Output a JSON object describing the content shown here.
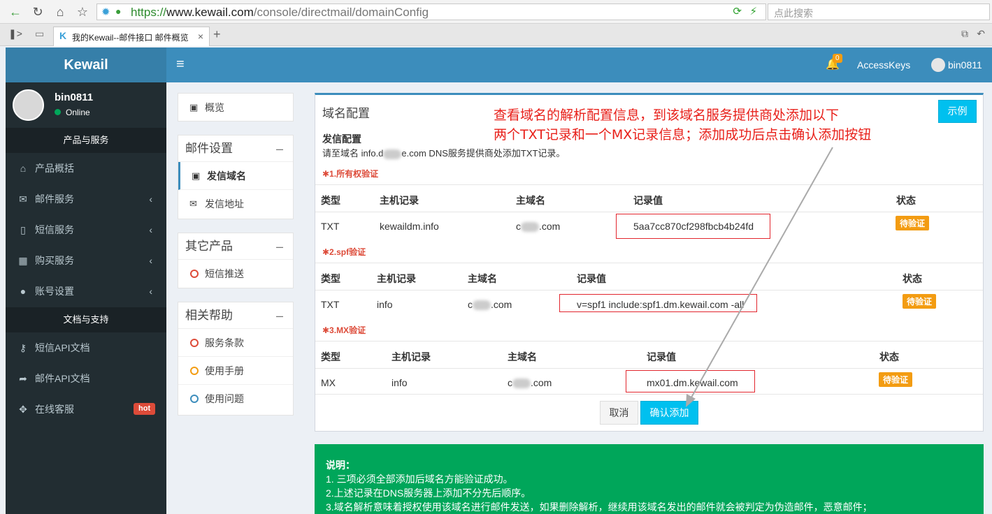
{
  "browser": {
    "url_scheme": "https://",
    "url_domain": "www.kewail.com",
    "url_path": "/console/directmail/domainConfig",
    "search_placeholder": "点此搜索",
    "tab_title": "我的Kewail--邮件接口 邮件概览",
    "new_tab": "+"
  },
  "header": {
    "brand": "Kewail",
    "menu_toggle": "≡",
    "bell_count": "0",
    "access_keys": "AccessKeys",
    "username": "bin0811"
  },
  "sidebar": {
    "user_name": "bin0811",
    "status": "Online",
    "section1": "产品与服务",
    "items1": [
      {
        "icon": "home-icon",
        "label": "产品概括"
      },
      {
        "icon": "envelope-icon",
        "label": "邮件服务"
      },
      {
        "icon": "mobile-icon",
        "label": "短信服务"
      },
      {
        "icon": "grid-icon",
        "label": "购买服务"
      },
      {
        "icon": "user-icon",
        "label": "账号设置"
      }
    ],
    "section2": "文档与支持",
    "items2": [
      {
        "icon": "key-icon",
        "label": "短信API文档"
      },
      {
        "icon": "share-icon",
        "label": "邮件API文档"
      },
      {
        "icon": "move-icon",
        "label": "在线客服",
        "badge": "hot"
      }
    ]
  },
  "left_panel": {
    "overview": "概览",
    "mail_settings": {
      "title": "邮件设置",
      "items": [
        "发信域名",
        "发信地址"
      ]
    },
    "other_products": {
      "title": "其它产品",
      "items": [
        "短信推送"
      ]
    },
    "help": {
      "title": "相关帮助",
      "items": [
        "服务条款",
        "使用手册",
        "使用问题"
      ]
    }
  },
  "main": {
    "title": "域名配置",
    "example_button": "示例",
    "annotation_line1": "查看域名的解析配置信息，到该域名服务提供商处添加以下",
    "annotation_line2": "两个TXT记录和一个MX记录信息；添加成功后点击确认添加按钮",
    "send_config_title": "发信配置",
    "send_config_desc_prefix": "请至域名 info.d",
    "send_config_desc_suffix": "e.com DNS服务提供商处添加TXT记录。",
    "columns": {
      "type": "类型",
      "host": "主机记录",
      "domain": "主域名",
      "value": "记录值",
      "status": "状态"
    },
    "records": [
      {
        "step": "✱1.所有权验证",
        "type": "TXT",
        "host": "kewaildm.info",
        "domain_prefix": "c",
        "domain_suffix": ".com",
        "value": "5aa7cc870cf298fbcb4b24fd",
        "status": "待验证"
      },
      {
        "step": "✱2.spf验证",
        "type": "TXT",
        "host": "info",
        "domain_prefix": "c",
        "domain_suffix": ".com",
        "value": "v=spf1 include:spf1.dm.kewail.com -all",
        "status": "待验证"
      },
      {
        "step": "✱3.MX验证",
        "type": "MX",
        "host": "info",
        "domain_prefix": "c",
        "domain_suffix": ".com",
        "value": "mx01.dm.kewail.com",
        "status": "待验证"
      }
    ],
    "cancel_button": "取消",
    "confirm_button": "确认添加"
  },
  "notes": {
    "title": "说明：",
    "lines": [
      "1. 三项必须全部添加后域名方能验证成功。",
      "2.上述记录在DNS服务器上添加不分先后顺序。",
      "3.域名解析意味着授权使用该域名进行邮件发送，如果删除解析，继续用该域名发出的邮件就会被判定为伪造邮件，恶意邮件；"
    ]
  },
  "colors": {
    "brand": "#367fa9",
    "topbar": "#3c8dbc",
    "sidebar": "#222d32",
    "accent_button": "#00c0ef",
    "badge": "#f39c12",
    "note": "#00a65a",
    "annotation": "#e8201a"
  }
}
